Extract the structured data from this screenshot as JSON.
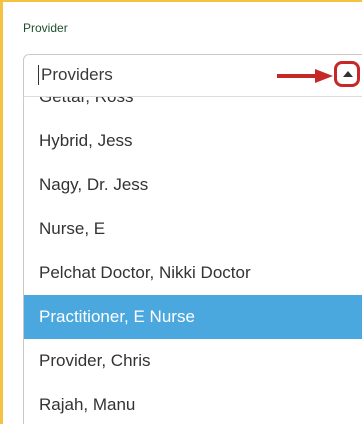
{
  "field": {
    "label": "Provider"
  },
  "select": {
    "value": "Providers",
    "toggle_icon": "caret-up-icon",
    "annotation_color": "#c62828"
  },
  "options": [
    {
      "label": "Gettar, Ross",
      "selected": false
    },
    {
      "label": "Hybrid, Jess",
      "selected": false
    },
    {
      "label": "Nagy, Dr. Jess",
      "selected": false
    },
    {
      "label": "Nurse, E",
      "selected": false
    },
    {
      "label": "Pelchat Doctor, Nikki Doctor",
      "selected": false
    },
    {
      "label": "Practitioner, E Nurse",
      "selected": true
    },
    {
      "label": "Provider, Chris",
      "selected": false
    },
    {
      "label": "Rajah, Manu",
      "selected": false
    }
  ],
  "colors": {
    "highlight": "#4aa8de",
    "frame_border": "#f5c242",
    "label_text": "#1f4e2e"
  }
}
